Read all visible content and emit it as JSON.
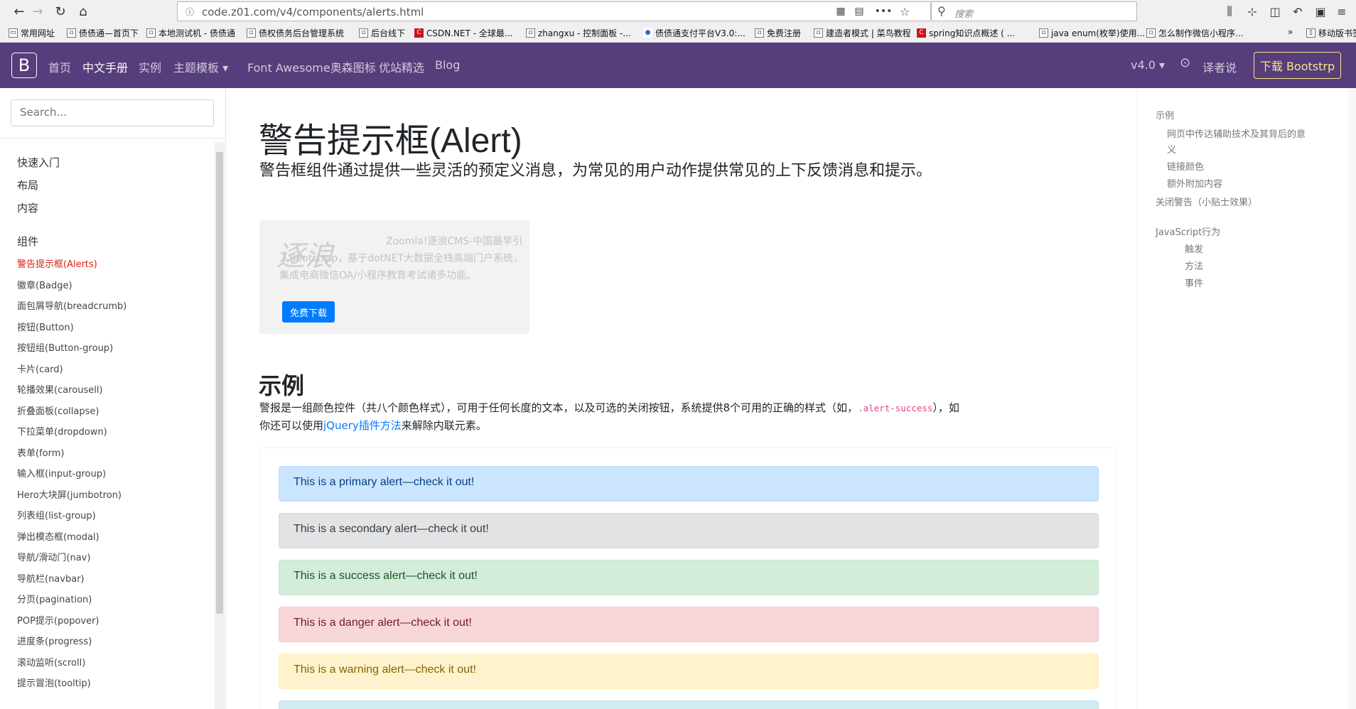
{
  "browser": {
    "url": "code.z01.com/v4/components/alerts.html",
    "search_placeholder": "搜索",
    "back": "←",
    "forward": "→",
    "reload": "↻",
    "home": "⌂",
    "bookmarks": [
      {
        "label": "常用网址",
        "icon": "folder-icon"
      },
      {
        "label": "债债通—首页下",
        "icon": "page-icon"
      },
      {
        "label": "本地测试机 - 债债通",
        "icon": "page-icon"
      },
      {
        "label": "债权债务后台管理系统",
        "icon": "page-icon"
      },
      {
        "label": "后台线下",
        "icon": "page-icon"
      },
      {
        "label": "CSDN.NET - 全球最...",
        "icon": "csdn-icon"
      },
      {
        "label": "zhangxu - 控制面板 -...",
        "icon": "page-icon"
      },
      {
        "label": "债债通支付平台V3.0:...",
        "icon": "globe-icon"
      },
      {
        "label": "免费注册",
        "icon": "page-icon"
      },
      {
        "label": "建造者模式 | 菜鸟教程",
        "icon": "page-icon"
      },
      {
        "label": "spring知识点概述 ( ...",
        "icon": "csdn-icon"
      },
      {
        "label": "java enum(枚举)使用...",
        "icon": "page-icon"
      },
      {
        "label": "怎么制作微信小程序...",
        "icon": "page-icon"
      },
      {
        "label": "移动版书签",
        "icon": "mobile-icon"
      }
    ],
    "overflow": "»"
  },
  "navbar": {
    "brand": "B",
    "links": [
      "首页",
      "中文手册",
      "实例",
      "主题模板 ▾",
      "Font Awesome奥森图标",
      "优站精选",
      "Blog"
    ],
    "version": "v4.0 ▾",
    "github": "⊙",
    "translators": "译者说",
    "download": "下载 Bootstrp"
  },
  "sidebar": {
    "search_placeholder": "Search...",
    "top_items": [
      "快速入门",
      "布局",
      "内容"
    ],
    "section": "组件",
    "items": [
      "警告提示框(Alerts)",
      "徽章(Badge)",
      "面包屑导航(breadcrumb)",
      "按钮(Button)",
      "按钮组(Button-group)",
      "卡片(card)",
      "轮播效果(carousell)",
      "折叠面板(collapse)",
      "下拉菜单(dropdown)",
      "表单(form)",
      "输入框(input-group)",
      "Hero大块屏(jumbotron)",
      "列表组(list-group)",
      "弹出模态框(modal)",
      "导航/滑动门(nav)",
      "导航栏(navbar)",
      "分页(pagination)",
      "POP提示(popover)",
      "进度条(progress)",
      "滚动监听(scroll)",
      "提示冒泡(tooltip)"
    ]
  },
  "main": {
    "title_cn": "警告提示框",
    "title_en": "(Alert)",
    "lead": "警告框组件通过提供一些灵活的预定义消息，为常见的用户动作提供常见的上下反馈消息和提示。",
    "ad": {
      "logo": "逐浪",
      "text": "Zoomla!逐浪CMS-中国最早引入Bootstrap，基于dotNET大数据全栈高端门户系统，集成电商微信OA/小程序教育考试诸多功能。",
      "button": "免费下载"
    },
    "section_title": "示例",
    "desc_part1": "警报是一组颜色控件（共八个颜色样式），可用于任何长度的文本，以及可选的关闭按钮，系统提供8个可用的正确的样式（如，",
    "desc_code": ".alert-success",
    "desc_part2": "），如你还可以使用",
    "desc_link": "jQuery插件方法",
    "desc_part3": "来解除内联元素。",
    "alerts": [
      {
        "text": "This is a primary alert—check it out!",
        "bg": "#cce5ff",
        "border": "#b8daff",
        "color": "#004085"
      },
      {
        "text": "This is a secondary alert—check it out!",
        "bg": "#e2e3e5",
        "border": "#d6d8db",
        "color": "#383d41"
      },
      {
        "text": "This is a success alert—check it out!",
        "bg": "#d4edda",
        "border": "#c3e6cb",
        "color": "#155724"
      },
      {
        "text": "This is a danger alert—check it out!",
        "bg": "#f8d7da",
        "border": "#f5c6cb",
        "color": "#721c24"
      },
      {
        "text": "This is a warning alert—check it out!",
        "bg": "#fff3cd",
        "border": "#ffeeba",
        "color": "#856404"
      },
      {
        "text": "",
        "bg": "#d1ecf1",
        "border": "#bee5eb",
        "color": "#0c5460"
      }
    ]
  },
  "toc": {
    "items": [
      {
        "label": "示例",
        "level": 1
      },
      {
        "label": "网页中传达辅助技术及其背后的意",
        "level": 2
      },
      {
        "label": "义",
        "level": 2
      },
      {
        "label": "链接颜色",
        "level": 2
      },
      {
        "label": "额外附加内容",
        "level": 2
      },
      {
        "label": "关闭警告（小贴士效果）",
        "level": 1
      },
      {
        "label": "JavaScript行为",
        "level": 1
      },
      {
        "label": "触发",
        "level": 3
      },
      {
        "label": "方法",
        "level": 3
      },
      {
        "label": "事件",
        "level": 3
      }
    ]
  },
  "colors": {
    "navbar": "#563d7c",
    "accent": "#ffe484",
    "active_link": "#d9230f",
    "code": "#e83e8c",
    "link": "#007bff"
  }
}
